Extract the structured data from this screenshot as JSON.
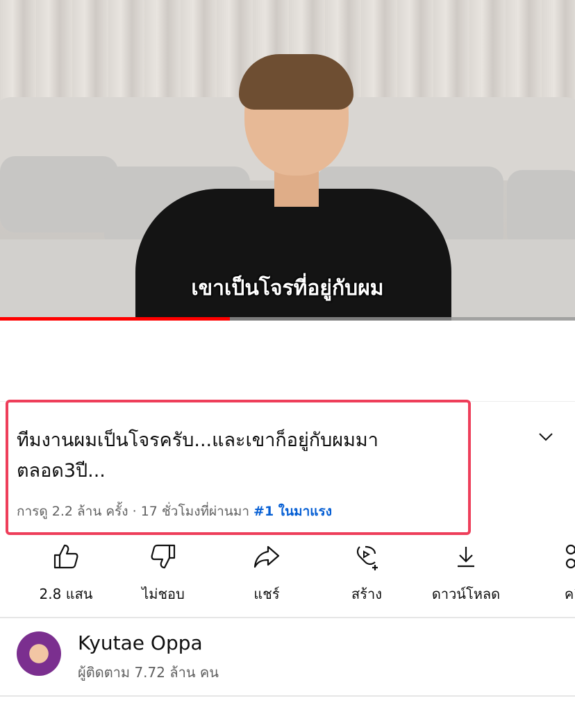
{
  "video": {
    "subtitle": "เขาเป็นโจรที่อยู่กับผม",
    "progress": 0.4,
    "progress_color": "#ff0000"
  },
  "title": "ทีมงานผมเป็นโจรครับ...และเขาก็อยู่กับผมมาตลอด3ปี...",
  "meta": {
    "views": "การดู 2.2 ล้าน ครั้ง",
    "separator": "·",
    "time": "17 ชั่วโมงที่ผ่านมา",
    "trending": "#1 ในมาแรง"
  },
  "actions": [
    {
      "icon": "thumbs-up-icon",
      "label": "2.8 แสน"
    },
    {
      "icon": "thumbs-down-icon",
      "label": "ไม่ชอบ"
    },
    {
      "icon": "share-icon",
      "label": "แชร์"
    },
    {
      "icon": "remix-create-icon",
      "label": "สร้าง"
    },
    {
      "icon": "download-icon",
      "label": "ดาวน์โหลด"
    },
    {
      "icon": "scissors-clip-icon",
      "label": "คลิป"
    }
  ],
  "channel": {
    "name": "Kyutae Oppa",
    "subscribers": "ผู้ติดตาม 7.72 ล้าน คน"
  },
  "colors": {
    "highlight_border": "#ee3e5a",
    "trend_link": "#065fd4",
    "secondary_text": "#606060"
  }
}
